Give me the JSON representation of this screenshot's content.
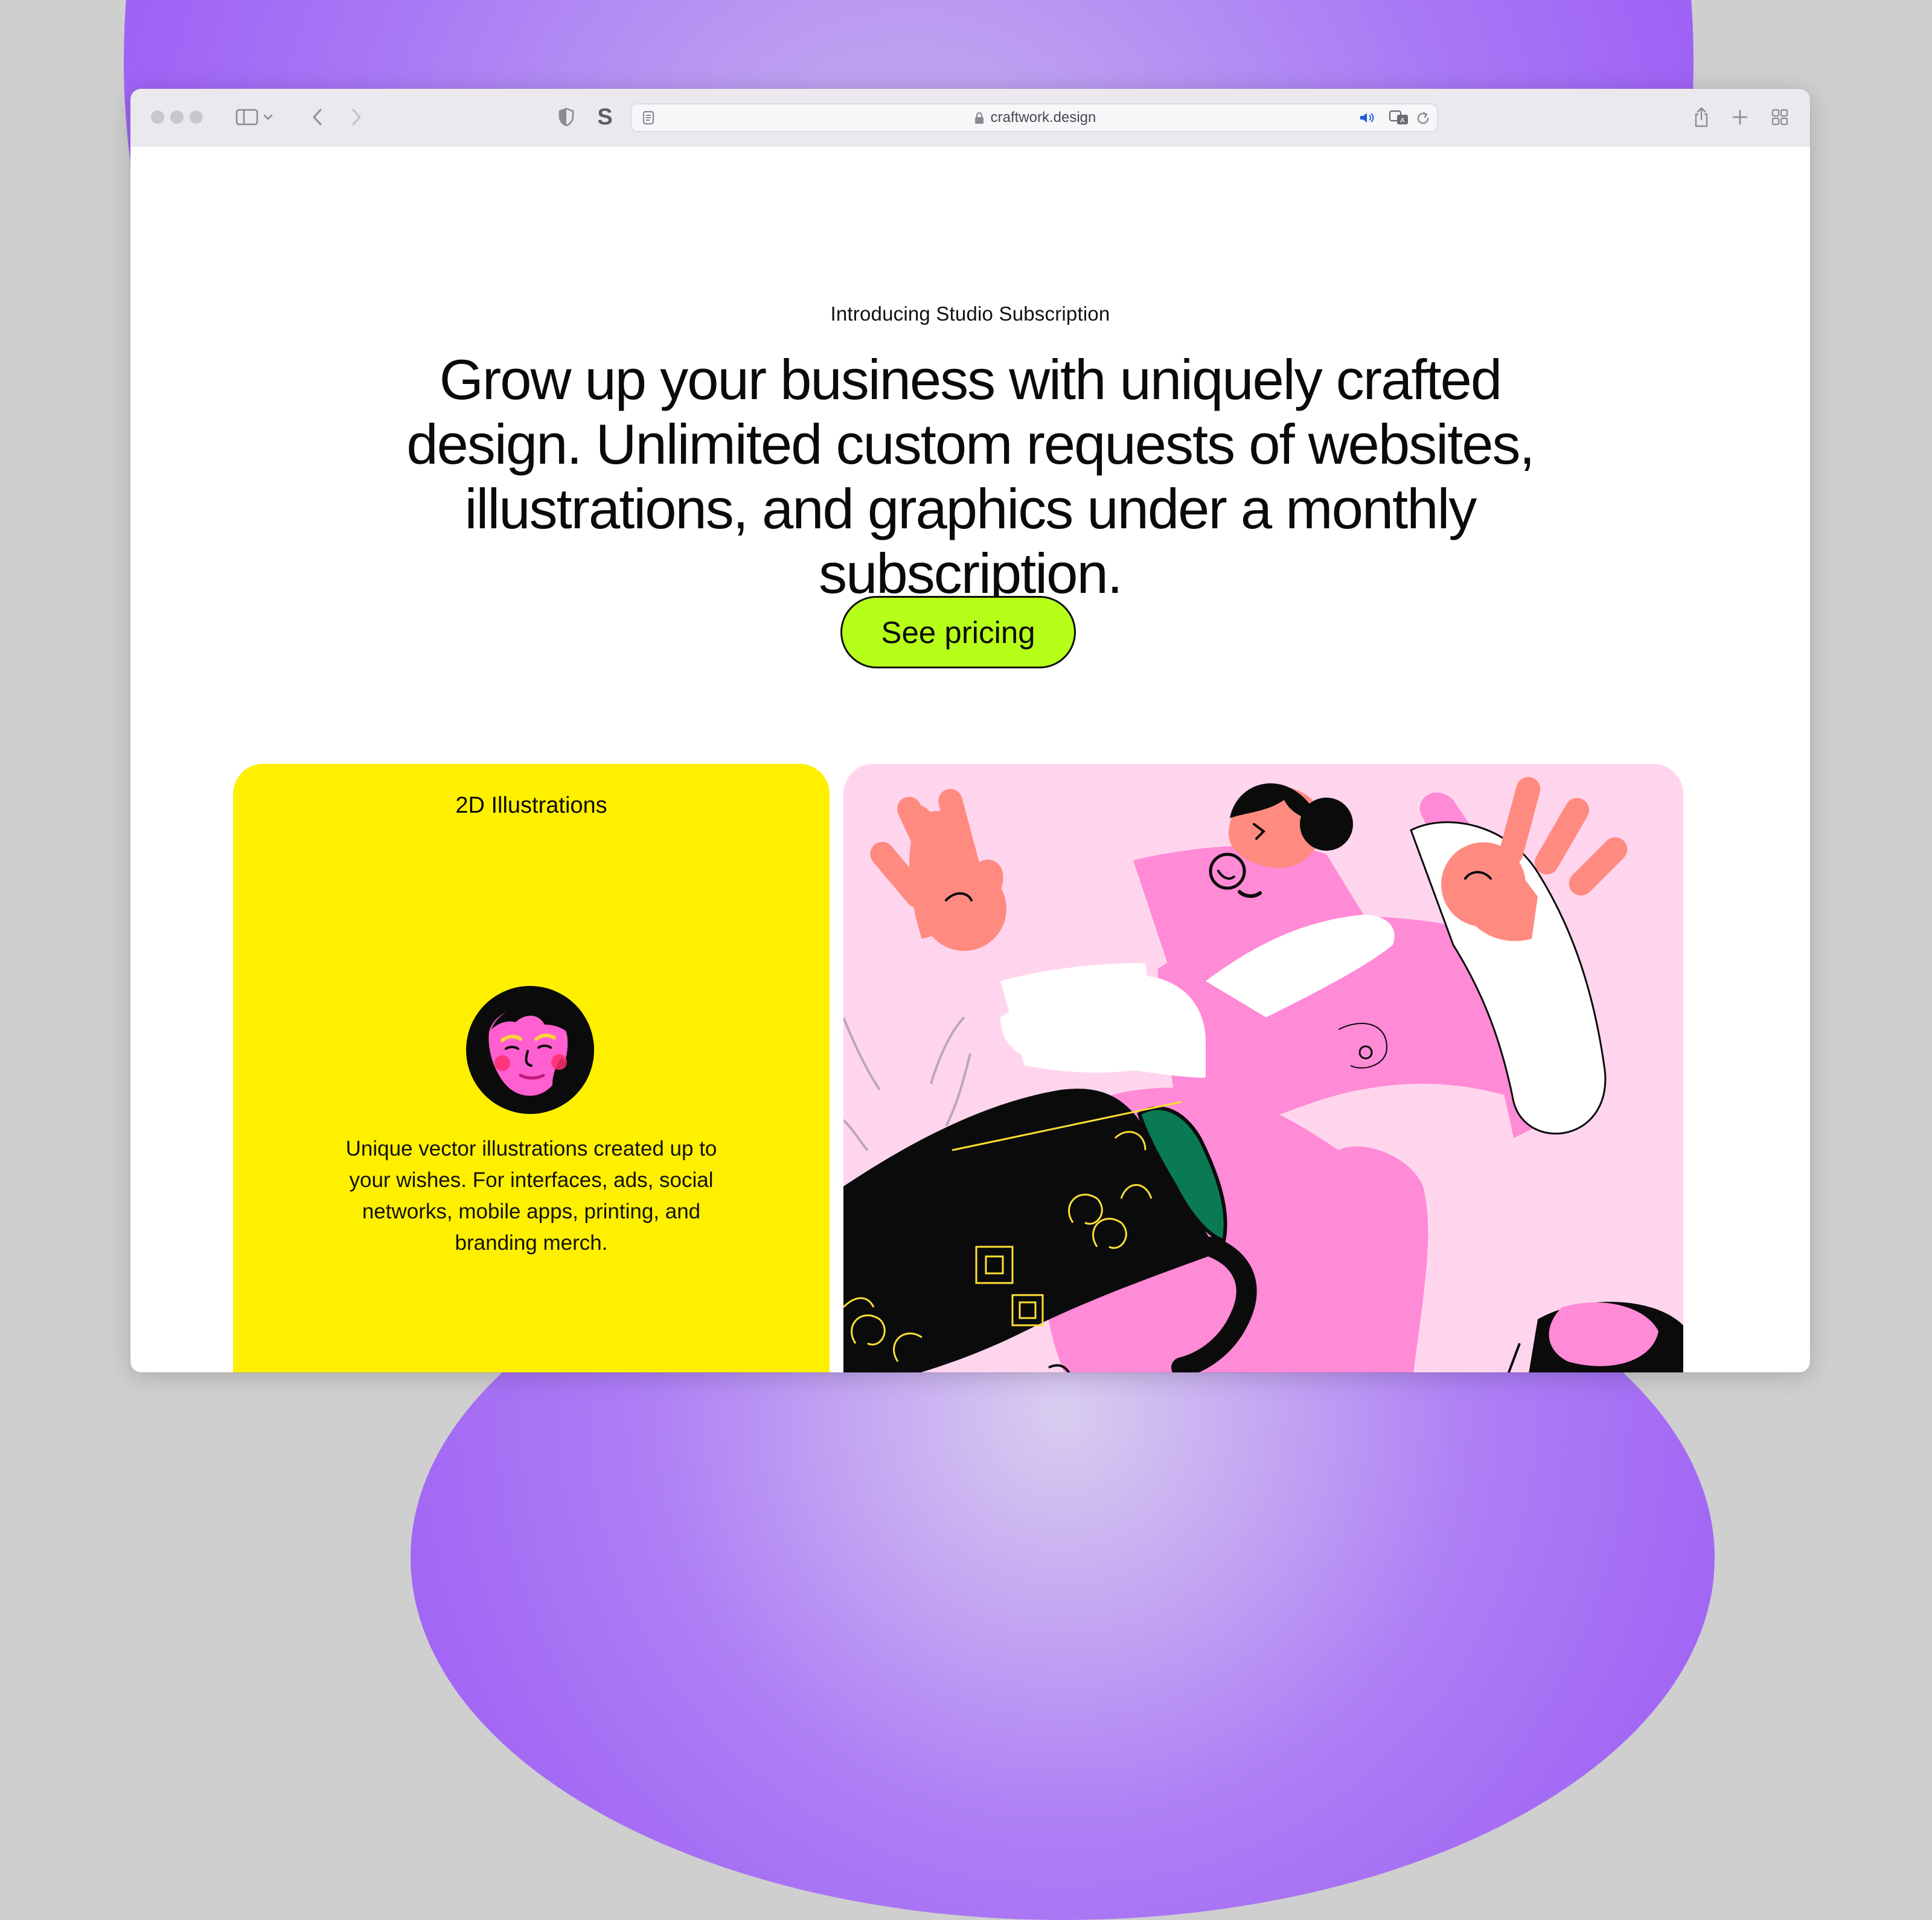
{
  "browser": {
    "url": "craftwork.design",
    "icons": {
      "sidebar": "sidebar-icon",
      "back": "chevron-left-icon",
      "forward": "chevron-right-icon",
      "privacy": "shield-icon",
      "extension": "s-extension-icon",
      "reader": "reader-icon",
      "lock": "lock-icon",
      "audio": "speaker-icon",
      "translate": "translate-icon",
      "reload": "reload-icon",
      "share": "share-icon",
      "new_tab": "plus-icon",
      "tab_overview": "grid-icon"
    },
    "extension_letter": "S"
  },
  "hero": {
    "eyebrow": "Introducing Studio Subscription",
    "headline": "Grow up your business with uniquely crafted design. Unlimited custom requests of websites, illustrations, and graphics under a monthly subscription.",
    "cta_label": "See pricing"
  },
  "services": {
    "card": {
      "title": "2D Illustrations",
      "description": "Unique vector illustrations created up to your wishes. For interfaces, ads, social networks, mobile apps, printing, and branding merch."
    }
  },
  "colors": {
    "cta_background": "#b6ff19",
    "card_yellow": "#fff000",
    "card_pink": "#ffd5ee",
    "illustration_pink": "#ff8ad6",
    "skin": "#ff8a80",
    "backdrop_purple": "#9c5cf5"
  }
}
